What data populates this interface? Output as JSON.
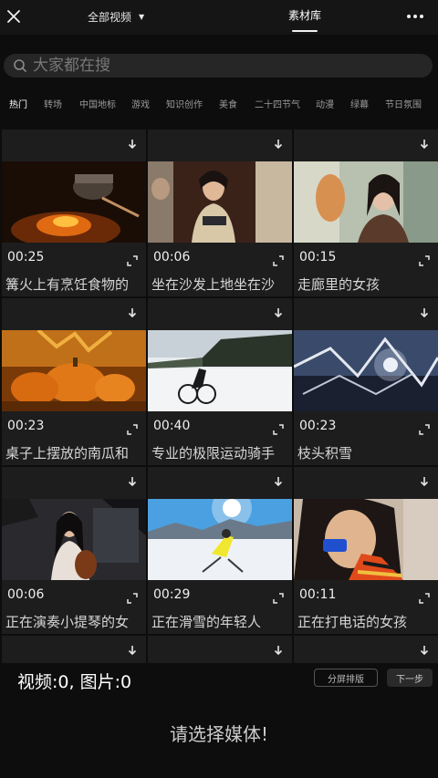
{
  "topbar": {
    "scope_label": "全部视频",
    "library_tab": "素材库",
    "icons": {
      "close": "close-icon",
      "dropdown": "caret-down-icon",
      "more": "more-horizontal-icon"
    }
  },
  "search": {
    "placeholder": "大家都在搜",
    "value": "",
    "icon": "search-icon"
  },
  "categories": [
    "热门",
    "转场",
    "中国地标",
    "游戏",
    "知识创作",
    "美食",
    "二十四节气",
    "动漫",
    "绿幕",
    "节日氛围"
  ],
  "active_category": "热门",
  "items": [
    {
      "duration": "00:25",
      "title": "篝火上有烹饪食物的"
    },
    {
      "duration": "00:06",
      "title": "坐在沙发上地坐在沙"
    },
    {
      "duration": "00:15",
      "title": "走廊里的女孩"
    },
    {
      "duration": "00:23",
      "title": "桌子上摆放的南瓜和"
    },
    {
      "duration": "00:40",
      "title": "专业的极限运动骑手"
    },
    {
      "duration": "00:23",
      "title": "枝头积雪"
    },
    {
      "duration": "00:06",
      "title": "正在演奏小提琴的女"
    },
    {
      "duration": "00:29",
      "title": "正在滑雪的年轻人"
    },
    {
      "duration": "00:11",
      "title": "正在打电话的女孩"
    }
  ],
  "bottom": {
    "counts": "视频:0, 图片:0",
    "split_button": "分屏排版",
    "next_button": "下一步",
    "empty_hint": "请选择媒体!"
  },
  "colors": {
    "background": "#0d0d0d",
    "cell": "#1d1d1d",
    "search_bg": "#262626",
    "active_text": "#ffffff",
    "inactive_text": "#9a9a9a"
  }
}
